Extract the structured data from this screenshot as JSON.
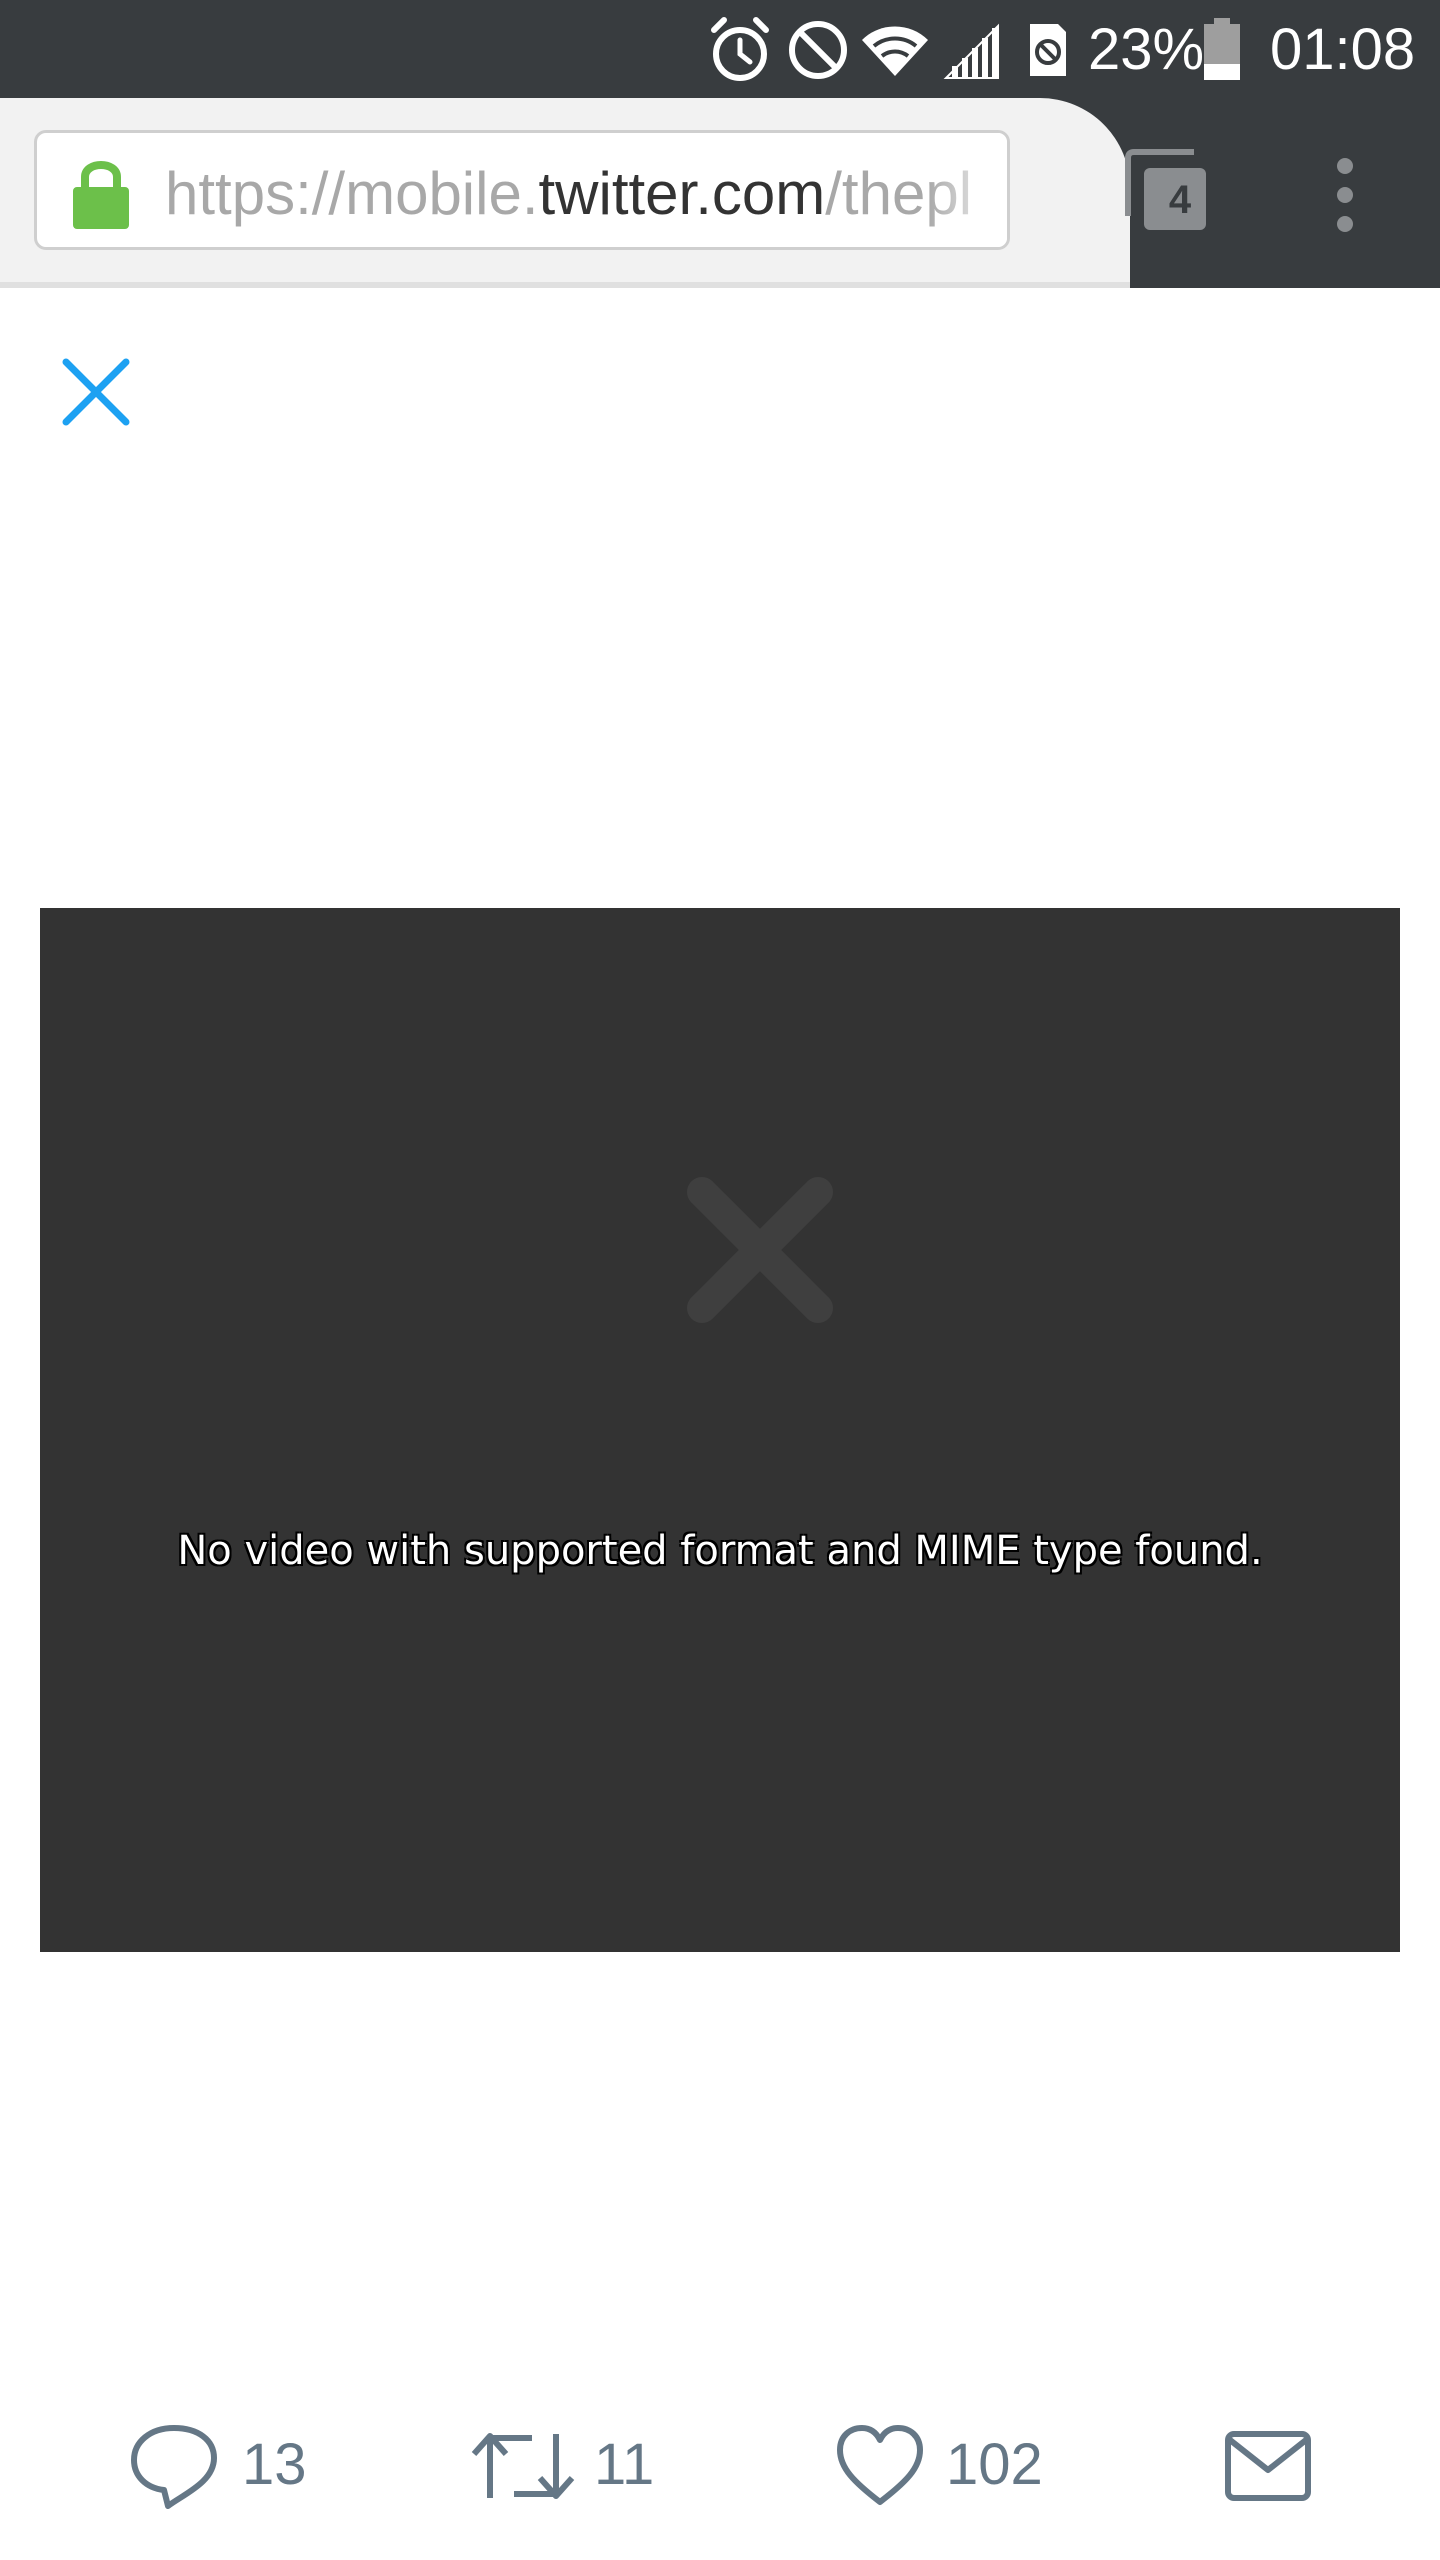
{
  "status_bar": {
    "battery": "23%",
    "time": "01:08",
    "icons": [
      "alarm-icon",
      "do-not-disturb-icon",
      "wifi-icon",
      "signal-icon",
      "data-saver-icon",
      "battery-icon"
    ]
  },
  "browser": {
    "url_scheme": "https://mobile.",
    "url_host": "twitter.com",
    "url_path": "/thepl",
    "tab_count": "4"
  },
  "video": {
    "error_message": "No video with supported format and MIME type found."
  },
  "actions": {
    "replies": "13",
    "retweets": "11",
    "likes": "102"
  },
  "colors": {
    "chrome_dark": "#383c3f",
    "lock_green": "#6cc04a",
    "twitter_blue": "#1da1f2",
    "action_gray": "#657786",
    "video_bg": "#333333"
  }
}
